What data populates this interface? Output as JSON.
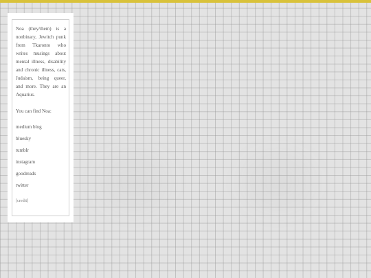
{
  "theme": {
    "accent": "#d9c23a",
    "background": "#e3e3e3",
    "panel": "#ffffff",
    "text": "#555555"
  },
  "sidebar": {
    "bio": "Noa (they/them) is a nonbinary, Jewitch punk from Tkaronto who writes musings about mental illness, disability and chronic illness, cats, Judaism, being queer, and more. They are an Aquarius.",
    "find_label": "You can find Noa:",
    "links": [
      {
        "label": "medium blog"
      },
      {
        "label": "bluesky"
      },
      {
        "label": "tumblr"
      },
      {
        "label": "instagram"
      },
      {
        "label": "goodreads"
      },
      {
        "label": "twitter"
      }
    ],
    "credit": "[credit]"
  }
}
